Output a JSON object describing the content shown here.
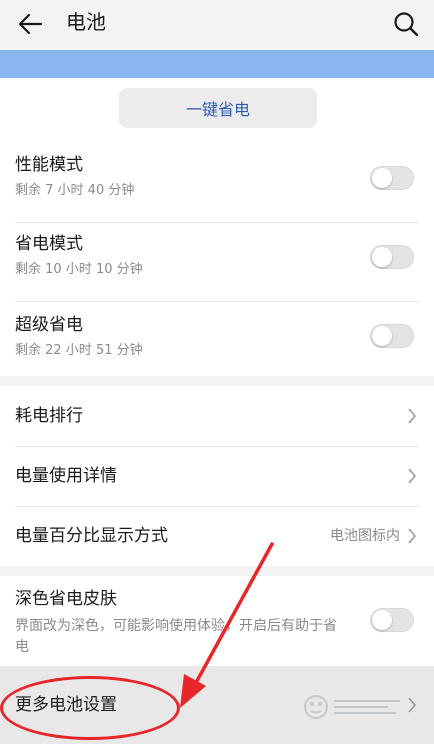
{
  "header": {
    "title": "电池",
    "back_icon": "arrow-left-icon",
    "search_icon": "search-icon"
  },
  "battery_bar": {
    "color": "#8ab6f3"
  },
  "one_key_button": {
    "label": "一键省电",
    "color": "#2a5bb5"
  },
  "modes": [
    {
      "label": "性能模式",
      "sub": "剩余 7 小时 40 分钟",
      "on": false
    },
    {
      "label": "省电模式",
      "sub": "剩余 10 小时 10 分钟",
      "on": false
    },
    {
      "label": "超级省电",
      "sub": "剩余 22 小时 51 分钟",
      "on": false
    }
  ],
  "menu": [
    {
      "label": "耗电排行"
    },
    {
      "label": "电量使用详情"
    },
    {
      "label": "电量百分比显示方式",
      "value": "电池图标内"
    }
  ],
  "dark_skin": {
    "label": "深色省电皮肤",
    "desc": "界面改为深色，可能影响使用体验，开启后有助于省电",
    "on": false
  },
  "more_settings": {
    "label": "更多电池设置"
  },
  "annotation_color": "#e8262a",
  "watermark_icon": "baidu-jingyan-watermark-icon"
}
